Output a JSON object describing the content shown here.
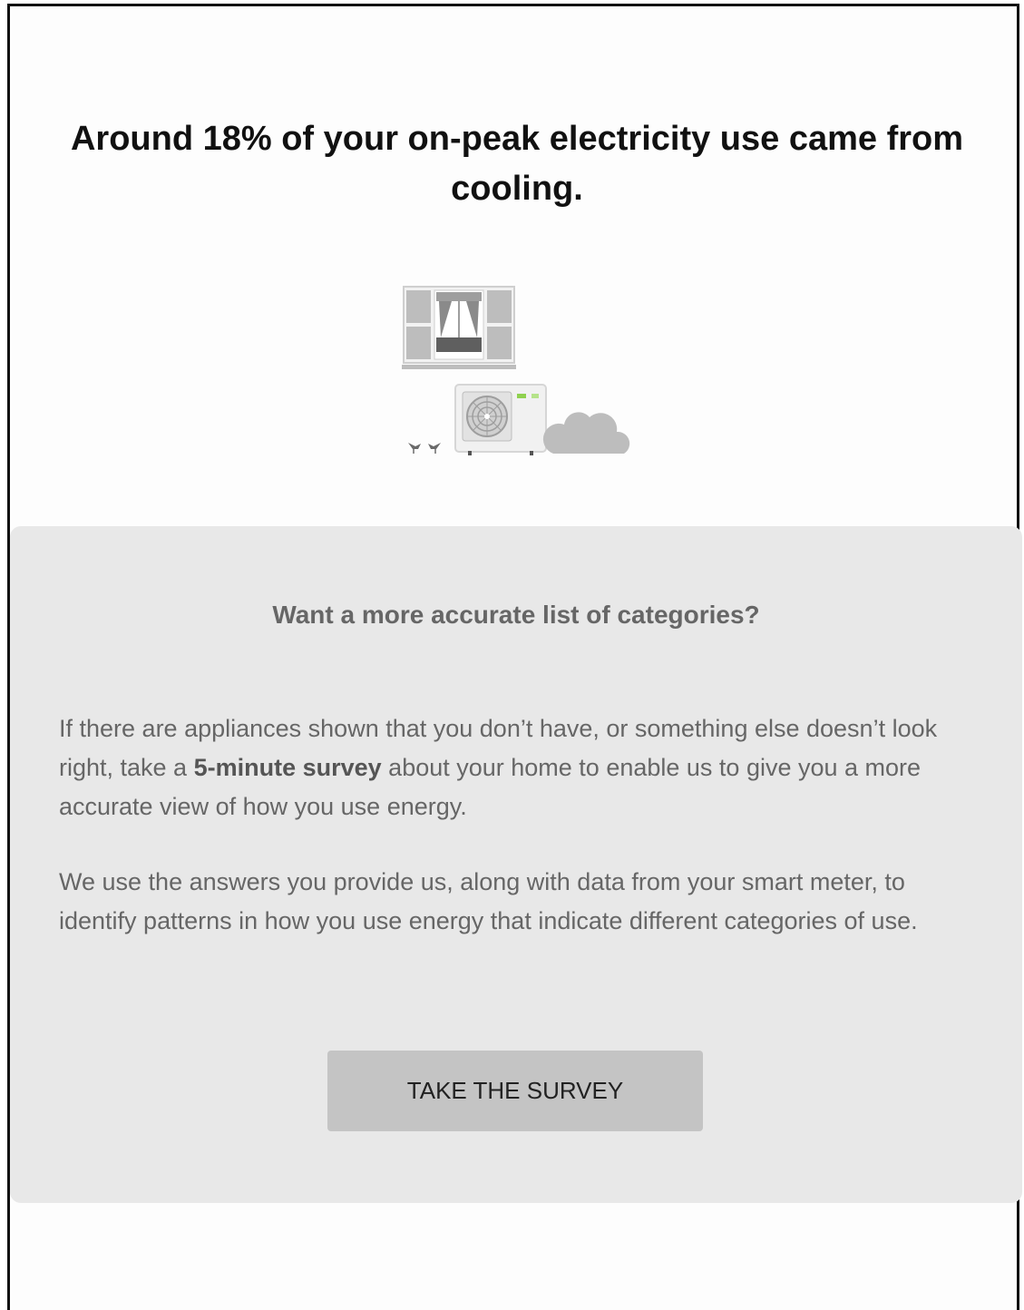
{
  "headline": "Around 18% of your on-peak electricity use came from cooling.",
  "illustration": {
    "icons": [
      "window-icon",
      "air-conditioner-icon",
      "bird-icon",
      "cloud-icon"
    ]
  },
  "survey_panel": {
    "title": "Want a more accurate list of categories?",
    "para1_before": "If there are appliances shown that you don’t have, or something else doesn’t look right, take a ",
    "para1_bold": "5-minute survey",
    "para1_after": " about your home to enable us to give you a more accurate view of how you use energy.",
    "para2": "We use the answers you provide us, along with data from your smart meter, to identify patterns in how you use energy that indicate different categories of use.",
    "button_label": "TAKE THE SURVEY"
  },
  "colors": {
    "panel_bg": "#e8e8e8",
    "button_bg": "#c4c4c4",
    "ac_indicator": "#8fd14f"
  }
}
